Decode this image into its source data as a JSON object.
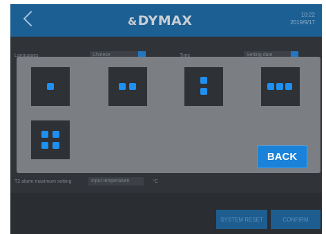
{
  "header": {
    "logo_symbol": "&",
    "logo_text": "DYMAX",
    "time": "10:22",
    "date": "2019/9/17"
  },
  "settings": {
    "languages_label": "Languages",
    "languages_value": "Chinese",
    "time_label": "Time",
    "time_value": "Setting date",
    "temp_alarm_label": "T2 alarm maximum setting",
    "temp_input_placeholder": "Input temperature",
    "temp_unit": "°C"
  },
  "modal": {
    "layouts": [
      {
        "name": "one",
        "icon": "single-square-icon"
      },
      {
        "name": "two-horizontal",
        "icon": "two-squares-horizontal-icon"
      },
      {
        "name": "two-vertical",
        "icon": "two-squares-vertical-icon"
      },
      {
        "name": "three-horizontal",
        "icon": "three-squares-horizontal-icon"
      },
      {
        "name": "four-grid",
        "icon": "four-squares-grid-icon"
      }
    ],
    "back_label": "BACK"
  },
  "footer": {
    "system_reset_label": "SYSTEM RESET",
    "confirm_label": "CONFIRM"
  },
  "colors": {
    "header_bg": "#1c5f92",
    "accent": "#1a82d8",
    "tile_dot": "#1f8ff0",
    "modal_bg": "#7b7f84"
  }
}
